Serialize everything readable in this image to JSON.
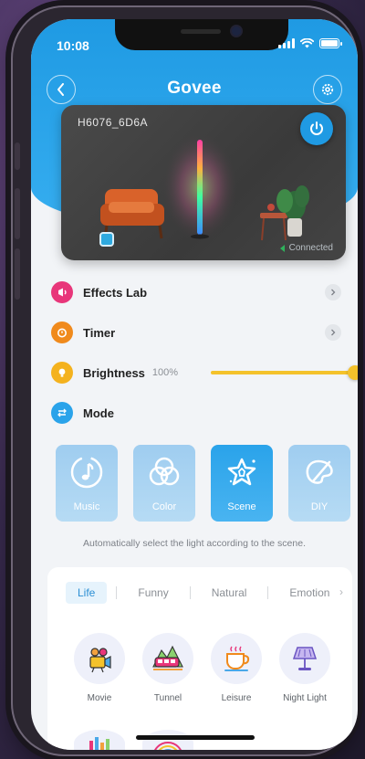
{
  "status": {
    "time": "10:08"
  },
  "nav": {
    "title": "Govee"
  },
  "device": {
    "name": "H6076_6D6A",
    "connection": "Connected"
  },
  "menu": {
    "effects_lab": "Effects Lab",
    "timer": "Timer",
    "brightness": "Brightness",
    "brightness_value": "100%",
    "brightness_level": 100,
    "mode": "Mode"
  },
  "modes": [
    {
      "label": "Music",
      "icon": "music-note-icon",
      "active": false
    },
    {
      "label": "Color",
      "icon": "color-circles-icon",
      "active": false
    },
    {
      "label": "Scene",
      "icon": "scene-star-icon",
      "active": true
    },
    {
      "label": "DIY",
      "icon": "palette-brush-icon",
      "active": false
    }
  ],
  "mode_description": "Automatically select the light according to the scene.",
  "scene_tabs": [
    "Life",
    "Funny",
    "Natural",
    "Emotion"
  ],
  "active_scene_tab": "Life",
  "scenes": [
    "Movie",
    "Tunnel",
    "Leisure",
    "Night Light"
  ],
  "colors": {
    "brand_blue": "#1f9ae3",
    "brightness_yellow": "#f4c22b",
    "effects_pink": "#e8367a",
    "timer_orange": "#f08a1c",
    "mode_blue": "#2aa3ea"
  }
}
